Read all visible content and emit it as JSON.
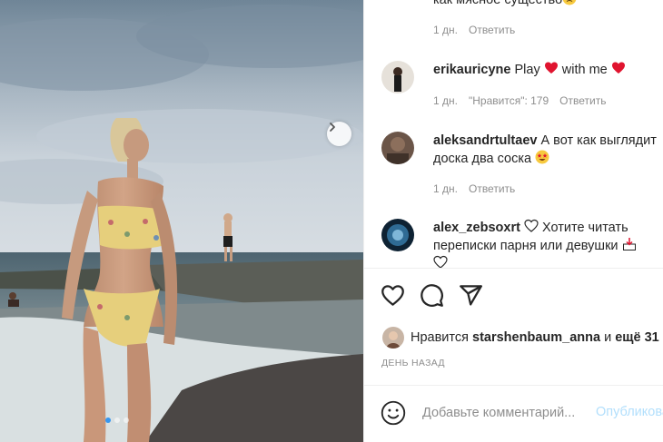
{
  "comments": [
    {
      "text": "как мясное существо",
      "emoji_after": "slightly-sad-face",
      "meta": {
        "age": "1 дн.",
        "reply": "Ответить"
      }
    },
    {
      "username": "erikauricyne",
      "text_1": "Play",
      "text_2": "with me",
      "emoji": "red-heart",
      "meta": {
        "age": "1 дн.",
        "likes": "\"Нравится\": 179",
        "reply": "Ответить"
      }
    },
    {
      "username": "aleksandrtultaev",
      "line_1": "А вот как выглядит",
      "line_2": "доска два соска",
      "emoji": "star-struck-face",
      "meta": {
        "age": "1 дн.",
        "reply": "Ответить"
      }
    },
    {
      "username": "alex_zebsoxrt",
      "line_1": "Хотите читать",
      "line_2": "переписки парня или девушки"
    }
  ],
  "actions": {
    "like": "heart-icon",
    "comment": "comment-icon",
    "share": "share-icon"
  },
  "likes": {
    "prefix": "Нравится",
    "user": "starshenbaum_anna",
    "joiner": "и",
    "more": "ещё 31"
  },
  "posted_ago": "ДЕНЬ НАЗАД",
  "add_comment": {
    "placeholder": "Добавьте комментарий...",
    "post_label": "Опубликовать"
  },
  "carousel": {
    "slide_count": 3,
    "active_index": 0
  },
  "colors": {
    "accent": "#3797f0",
    "heart": "#ed4956",
    "muted": "#8e8e8e",
    "post_disabled": "#b2dffc"
  }
}
